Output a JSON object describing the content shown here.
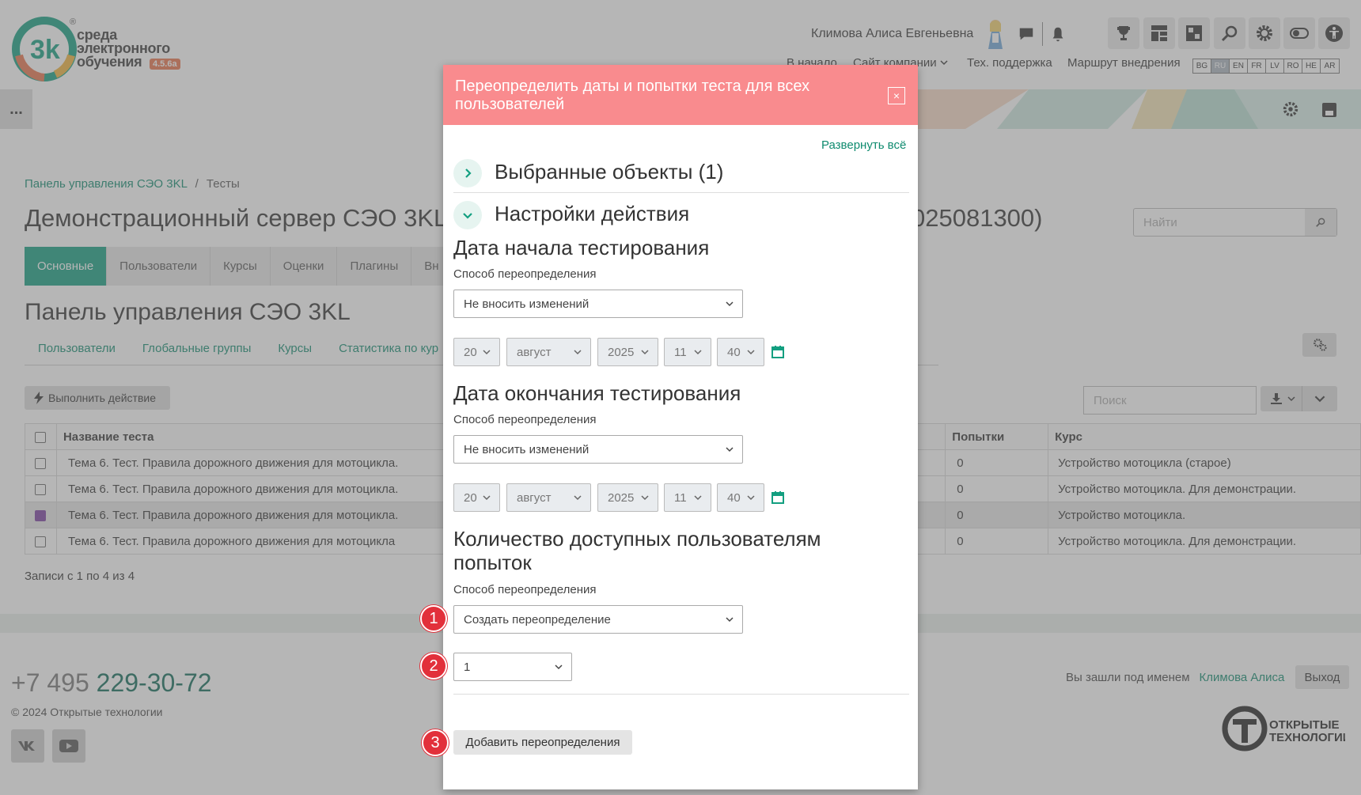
{
  "header": {
    "logo_registered": "®",
    "logo_line1": "среда",
    "logo_line2": "электронного",
    "logo_line3": "обучения",
    "logo_version": "4.5.6a",
    "username": "Климова Алиса Евгеньевна",
    "nav": [
      "В начало",
      "Сайт компании",
      "Тех. поддержка",
      "Маршрут внедрения"
    ],
    "langs": [
      "BG",
      "RU",
      "EN",
      "FR",
      "LV",
      "RO",
      "HE",
      "AR"
    ],
    "active_lang": "RU",
    "icons": [
      "chat-icon",
      "bell-icon",
      "trophy-icon",
      "dashboard-icon",
      "puzzle-icon",
      "search-icon",
      "gear-icon",
      "toggle-icon",
      "accessibility-icon"
    ]
  },
  "dots_label": "...",
  "breadcrumb": [
    "Панель управления СЭО 3KL",
    "Тесты"
  ],
  "breadcrumb_sep": "/",
  "page_title_left": "Демонстрационный сервер СЭО 3KL I",
  "page_title_right": "025081300)",
  "search_placeholder": "Найти",
  "tabs": [
    "Основные",
    "Пользователи",
    "Курсы",
    "Оценки",
    "Плагины",
    "Вн"
  ],
  "panel_title": "Панель управления СЭО 3KL",
  "subnav": [
    "Пользователи",
    "Глобальные группы",
    "Курсы",
    "Статистика по кур"
  ],
  "action_button": "Выполнить действие",
  "table_search_placeholder": "Поиск",
  "table": {
    "headers": [
      "Название теста",
      "Попытки",
      "Курс"
    ],
    "rows": [
      {
        "name": "Тема 6. Тест. Правила дорожного движения для мотоцикла.",
        "attempts": "0",
        "course": "Устройство мотоцикла (старое)"
      },
      {
        "name": "Тема 6. Тест. Правила дорожного движения для мотоцикла.",
        "attempts": "0",
        "course": "Устройство мотоцикла. Для демонстрации."
      },
      {
        "name": "Тема 6. Тест. Правила дорожного движения для мотоцикла.",
        "attempts": "0",
        "course": "Устройство мотоцикла."
      },
      {
        "name": "Тема 6. Тест. Правила дорожного движения для мотоцикла",
        "attempts": "0",
        "course": "Устройство мотоцикла. Для демонстрации."
      }
    ]
  },
  "records": "Записи с 1 по 4 из 4",
  "footer": {
    "phone_prefix": "+7 495",
    "phone_number": "229-30-72",
    "copyright": "© 2024  Открытые технологии",
    "logged_in_as": "Вы зашли под именем",
    "user_link": "Климова Алиса",
    "exit": "Выход",
    "ot_logo_line1": "ОТКРЫТЫЕ",
    "ot_logo_line2": "ТЕХНОЛОГИИ"
  },
  "modal": {
    "title": "Переопределить даты и попытки теста для всех пользователей",
    "close": "×",
    "expand_all": "Развернуть всё",
    "selected_objects": "Выбранные объекты (1)",
    "action_settings": "Настройки действия",
    "start_date": {
      "title": "Дата начала тестирования",
      "method_label": "Способ переопределения",
      "method": "Не вносить изменений",
      "day": "20",
      "month": "август",
      "year": "2025",
      "hour": "11",
      "minute": "40"
    },
    "end_date": {
      "title": "Дата окончания тестирования",
      "method_label": "Способ переопределения",
      "method": "Не вносить изменений",
      "day": "20",
      "month": "август",
      "year": "2025",
      "hour": "11",
      "minute": "40"
    },
    "attempts": {
      "title": "Количество доступных пользователям попыток",
      "method_label": "Способ переопределения",
      "method": "Создать переопределение",
      "value": "1"
    },
    "add_button": "Добавить переопределения",
    "markers": [
      "1",
      "2",
      "3"
    ]
  },
  "colors": {
    "accent": "#139f80",
    "modal_header": "#f98b8e",
    "marker": "#e2303b"
  }
}
